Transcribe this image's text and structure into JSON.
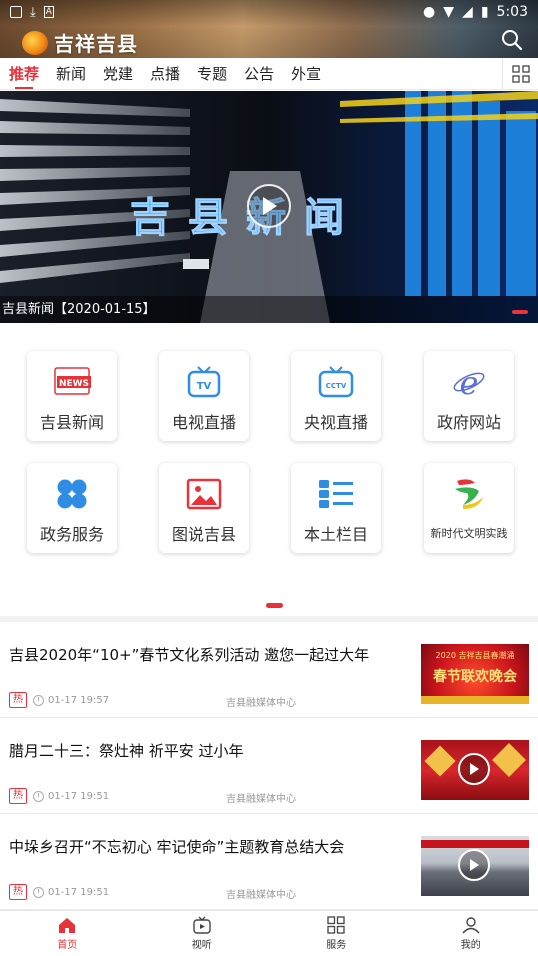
{
  "status_bar": {
    "time": "5:03"
  },
  "header": {
    "app_name": "吉祥吉县"
  },
  "tabs": [
    {
      "label": "推荐",
      "active": true
    },
    {
      "label": "新闻"
    },
    {
      "label": "党建"
    },
    {
      "label": "点播"
    },
    {
      "label": "专题"
    },
    {
      "label": "公告"
    },
    {
      "label": "外宣"
    }
  ],
  "banner": {
    "caption": "吉县新闻【2020-01-15】",
    "overlay_text": "吉县新闻"
  },
  "services": [
    {
      "label": "吉县新闻",
      "icon": "news-icon"
    },
    {
      "label": "电视直播",
      "icon": "tv-icon"
    },
    {
      "label": "央视直播",
      "icon": "cctv-icon"
    },
    {
      "label": "政府网站",
      "icon": "ie-icon"
    },
    {
      "label": "政务服务",
      "icon": "clover-icon"
    },
    {
      "label": "图说吉县",
      "icon": "image-icon"
    },
    {
      "label": "本土栏目",
      "icon": "list-icon"
    },
    {
      "label": "新时代文明实践",
      "icon": "civilization-logo-icon"
    }
  ],
  "news": [
    {
      "title": "吉县2020年“10+”春节文化系列活动 邀您一起过大年",
      "hot": "热",
      "time": "01-17 19:57",
      "source": "吉县融媒体中心",
      "thumb_caption": "春节联欢晚会",
      "thumb_top": "2020 吉祥吉县春潮涌",
      "video": false
    },
    {
      "title": "腊月二十三：祭灶神  祈平安  过小年",
      "hot": "热",
      "time": "01-17 19:51",
      "source": "吉县融媒体中心",
      "video": true
    },
    {
      "title": "中垛乡召开“不忘初心  牢记使命”主题教育总结大会",
      "hot": "热",
      "time": "01-17 19:51",
      "source": "吉县融媒体中心",
      "video": true
    }
  ],
  "bottom_nav": [
    {
      "label": "首页",
      "icon": "home-icon",
      "active": true
    },
    {
      "label": "视听",
      "icon": "tv-play-icon"
    },
    {
      "label": "服务",
      "icon": "grid-icon"
    },
    {
      "label": "我的",
      "icon": "user-icon"
    }
  ],
  "colors": {
    "accent": "#e8323a"
  }
}
